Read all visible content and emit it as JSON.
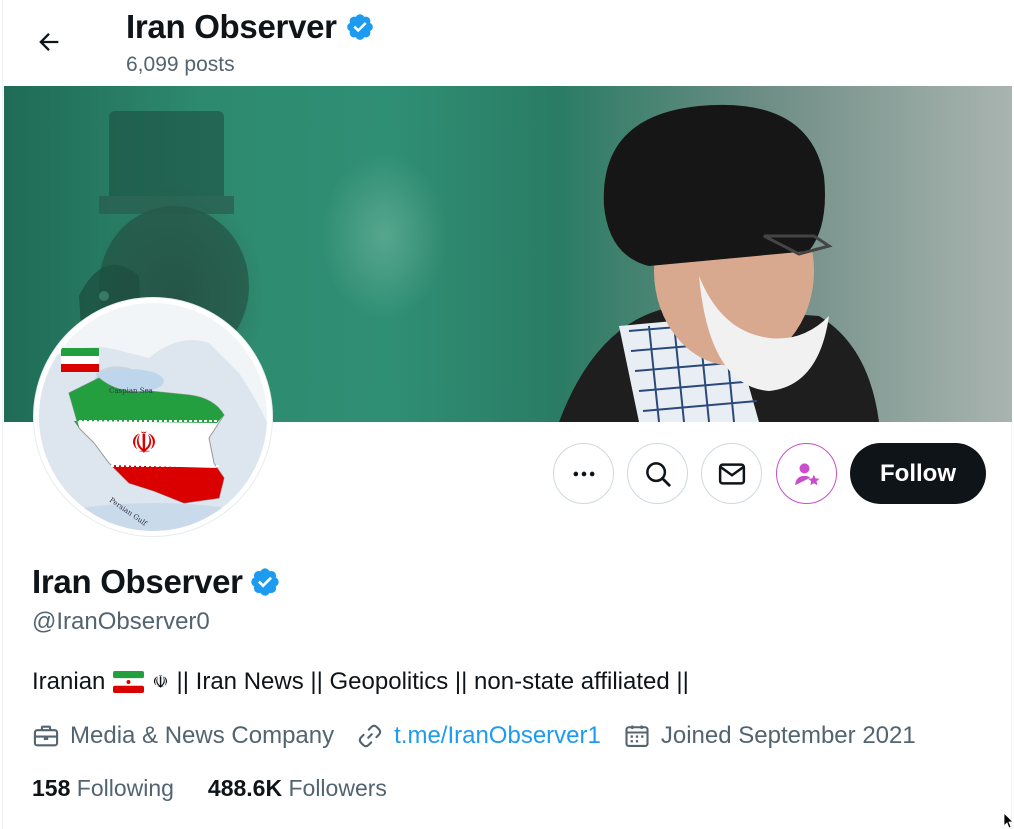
{
  "header": {
    "title": "Iran Observer",
    "posts": "6,099 posts",
    "back_icon": "arrow-left-icon"
  },
  "profile": {
    "name": "Iran Observer",
    "handle": "@IranObserver0",
    "verified": true,
    "bio": {
      "prefix": "Iranian",
      "emblem": "☫",
      "text": "|| Iran News || Geopolitics || non-state affiliated ||"
    },
    "category": "Media & News Company",
    "link": "t.me/IranObserver1",
    "joined": "Joined September 2021"
  },
  "avatar": {
    "labels": [
      "Caspian Sea",
      "Persian Gulf"
    ]
  },
  "actions": {
    "more_icon": "ellipsis-icon",
    "search_icon": "search-icon",
    "message_icon": "mail-icon",
    "subscribe_icon": "person-star-icon",
    "follow_label": "Follow"
  },
  "stats": {
    "following_count": "158",
    "following_label": "Following",
    "followers_count": "488.6K",
    "followers_label": "Followers"
  },
  "colors": {
    "accent": "#1d9bf0",
    "text_primary": "#0f1419",
    "text_secondary": "#536471",
    "subscribe_accent": "#c94ecb",
    "flag_green": "#239f40",
    "flag_red": "#da0000"
  }
}
